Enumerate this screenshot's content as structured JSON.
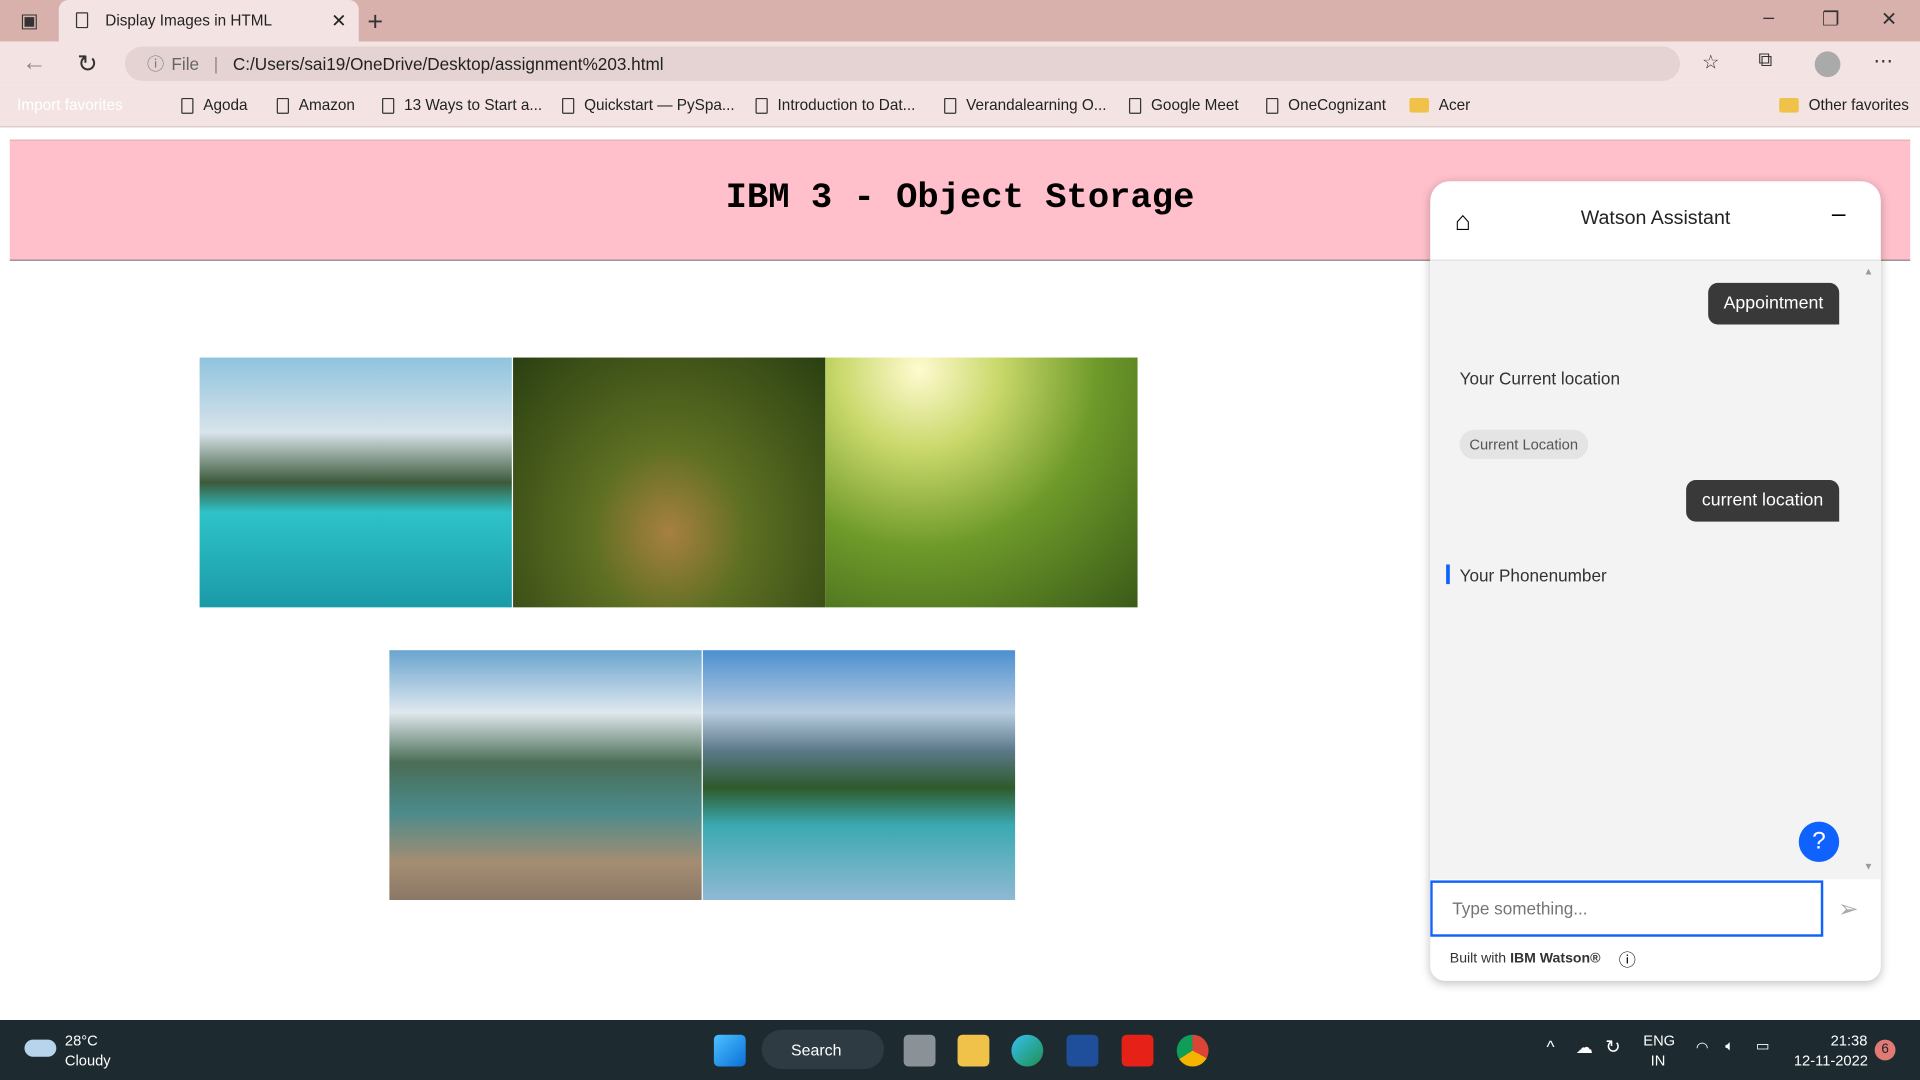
{
  "browser": {
    "tab_title": "Display Images in HTML",
    "address_prefix": "File",
    "url": "C:/Users/sai19/OneDrive/Desktop/assignment%203.html",
    "bookmarks": [
      "Import favorites",
      "Agoda",
      "Amazon",
      "13 Ways to Start a...",
      "Quickstart — PySpa...",
      "Introduction to Dat...",
      "Verandalearning O...",
      "Google Meet",
      "OneCognizant",
      "Acer"
    ],
    "other_favorites": "Other favorites"
  },
  "page": {
    "title": "IBM 3 - Object Storage"
  },
  "chat": {
    "title": "Watson Assistant",
    "messages": [
      {
        "from": "user",
        "text": "Appointment"
      },
      {
        "from": "bot",
        "text": "Your Current location"
      },
      {
        "from": "bot-option",
        "text": "Current Location"
      },
      {
        "from": "user",
        "text": "current location"
      },
      {
        "from": "bot",
        "text": "Your Phonenumber"
      }
    ],
    "input_placeholder": "Type something...",
    "footer_prefix": "Built with ",
    "footer_brand": "IBM Watson®",
    "help": "?"
  },
  "taskbar": {
    "temp": "28°C",
    "weather": "Cloudy",
    "search": "Search",
    "lang1": "ENG",
    "lang2": "IN",
    "time": "21:38",
    "date": "12-11-2022",
    "badge": "6"
  },
  "colors": {
    "header": "#ffc0cb",
    "accent": "#0f62fe",
    "tabbar": "#d8b1ad"
  }
}
